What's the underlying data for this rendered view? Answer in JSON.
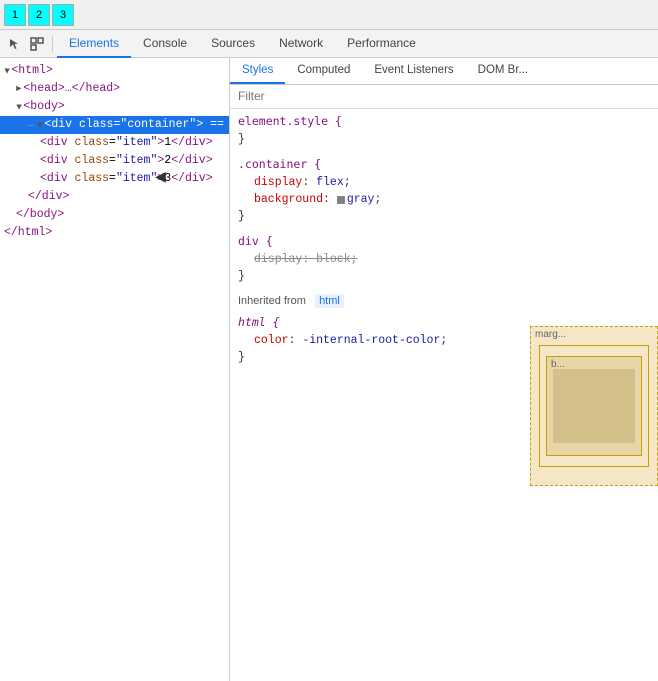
{
  "preview": {
    "box1": "1",
    "box2": "2",
    "box3": "3"
  },
  "toolbar": {
    "icons": [
      "cursor-icon",
      "inspect-icon"
    ],
    "tabs": [
      {
        "label": "Elements",
        "active": true
      },
      {
        "label": "Console",
        "active": false
      },
      {
        "label": "Sources",
        "active": false
      },
      {
        "label": "Network",
        "active": false
      },
      {
        "label": "Performance",
        "active": false
      }
    ]
  },
  "styles_subtabs": [
    {
      "label": "Styles",
      "active": true
    },
    {
      "label": "Computed",
      "active": false
    },
    {
      "label": "Event Listeners",
      "active": false
    },
    {
      "label": "DOM Br...",
      "active": false
    }
  ],
  "filter_placeholder": "Filter",
  "html_tree": [
    {
      "indent": 0,
      "content": "html",
      "type": "open-tag",
      "triangle": true
    },
    {
      "indent": 1,
      "content": "head",
      "type": "collapsed",
      "triangle": true
    },
    {
      "indent": 1,
      "content": "body",
      "type": "open-tag",
      "triangle": true
    },
    {
      "indent": 2,
      "content": "div",
      "type": "selected",
      "triangle": true,
      "attr_name": "class",
      "attr_value": "container"
    },
    {
      "indent": 3,
      "content": "div",
      "type": "open",
      "attr_name": "class",
      "attr_value": "item",
      "text": "1"
    },
    {
      "indent": 3,
      "content": "div",
      "type": "open",
      "attr_name": "class",
      "attr_value": "item",
      "text": "2"
    },
    {
      "indent": 3,
      "content": "div",
      "type": "open",
      "attr_name": "class",
      "attr_value": "item",
      "text": "3"
    },
    {
      "indent": 2,
      "content": "/div",
      "type": "close"
    },
    {
      "indent": 1,
      "content": "/body",
      "type": "close"
    },
    {
      "indent": 0,
      "content": "/html",
      "type": "close"
    }
  ],
  "styles": {
    "element_style": {
      "selector": "element.style {",
      "close": "}"
    },
    "container_rule": {
      "selector": ".container {",
      "close": "}",
      "properties": [
        {
          "name": "display",
          "value": "flex",
          "strikethrough": false
        },
        {
          "name": "background",
          "value": "gray",
          "strikethrough": false,
          "has_swatch": true,
          "swatch_color": "#808080"
        }
      ]
    },
    "div_rule": {
      "selector": "div {",
      "close": "}",
      "properties": [
        {
          "name": "display",
          "value": "block",
          "strikethrough": true
        }
      ]
    },
    "inherited_label": "Inherited from",
    "inherited_tag": "html",
    "html_rule": {
      "selector": "html {",
      "close": "}",
      "properties": [
        {
          "name": "color",
          "value": "-internal-root-color",
          "strikethrough": false
        }
      ]
    }
  },
  "box_model": {
    "label": "marg...",
    "inner_label": "b..."
  }
}
